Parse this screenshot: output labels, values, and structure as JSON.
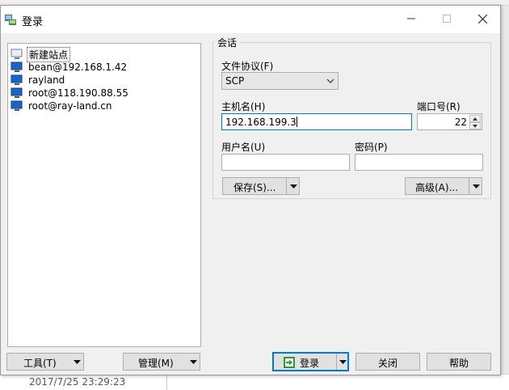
{
  "background": {
    "status_text": "2017/7/25   23:29:23"
  },
  "window": {
    "title": "登录",
    "controls": {
      "minimize": "—",
      "maximize": "☐",
      "close": "✕"
    }
  },
  "sites": [
    {
      "label": "新建站点",
      "icon": "new-site-icon",
      "selected": true
    },
    {
      "label": "bean@192.168.1.42",
      "icon": "computer-icon"
    },
    {
      "label": "rayland",
      "icon": "computer-icon"
    },
    {
      "label": "root@118.190.88.55",
      "icon": "computer-icon"
    },
    {
      "label": "root@ray-land.cn",
      "icon": "computer-icon"
    }
  ],
  "session": {
    "legend": "会话",
    "protocol_label": "文件协议(F)",
    "protocol_value": "SCP",
    "host_label": "主机名(H)",
    "host_value": "192.168.199.3",
    "port_label": "端口号(R)",
    "port_value": "22",
    "user_label": "用户名(U)",
    "user_value": "",
    "password_label": "密码(P)",
    "password_value": "",
    "save_button": "保存(S)...",
    "advanced_button": "高级(A)..."
  },
  "footer": {
    "tools_button": "工具(T)",
    "manage_button": "管理(M)",
    "login_button": "登录",
    "close_button": "关闭",
    "help_button": "帮助"
  },
  "colors": {
    "focus_border": "#0078d7",
    "button_face": "#e1e1e1",
    "window_bg": "#f0f0f0",
    "login_icon": "#2e9a2e"
  }
}
